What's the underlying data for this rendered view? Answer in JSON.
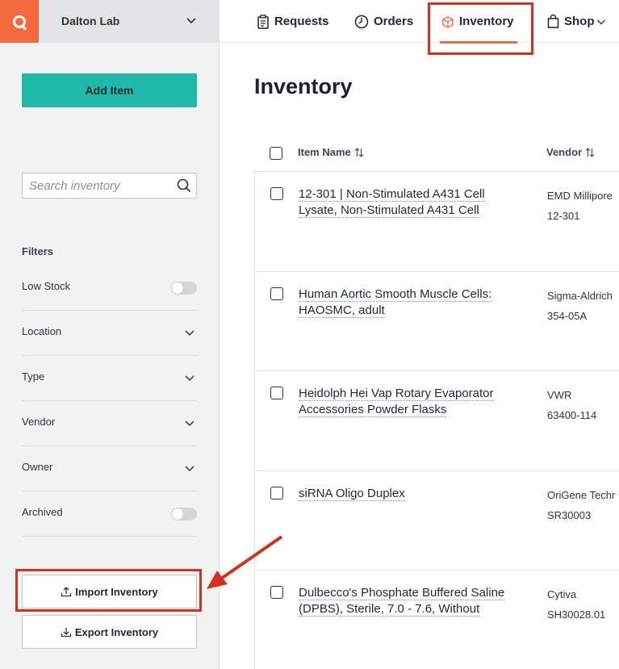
{
  "sidebar": {
    "lab_name": "Dalton Lab",
    "add_item_label": "Add Item",
    "search_placeholder": "Search inventory",
    "filters_title": "Filters",
    "filters": [
      {
        "label": "Low Stock",
        "kind": "toggle",
        "on": false
      },
      {
        "label": "Location",
        "kind": "dropdown"
      },
      {
        "label": "Type",
        "kind": "dropdown"
      },
      {
        "label": "Vendor",
        "kind": "dropdown"
      },
      {
        "label": "Owner",
        "kind": "dropdown"
      },
      {
        "label": "Archived",
        "kind": "toggle",
        "on": false
      }
    ],
    "import_label": "Import Inventory",
    "export_label": "Export Inventory"
  },
  "nav": {
    "items": [
      {
        "label": "Requests",
        "icon": "clipboard-icon"
      },
      {
        "label": "Orders",
        "icon": "clock-icon"
      },
      {
        "label": "Inventory",
        "icon": "box-icon",
        "active": true
      },
      {
        "label": "Shop",
        "icon": "shopping-bag-icon"
      }
    ]
  },
  "main": {
    "title": "Inventory",
    "columns": [
      {
        "label": "Item Name"
      },
      {
        "label": "Vendor"
      }
    ],
    "rows": [
      {
        "name_line1": "12-301 | Non-Stimulated A431 Cell",
        "name_line2": "Lysate, Non-Stimulated A431 Cell",
        "vendor": "EMD Millipore",
        "catalog": "12-301"
      },
      {
        "name_line1": "Human Aortic Smooth Muscle Cells:",
        "name_line2": "HAOSMC, adult",
        "vendor": "Sigma-Aldrich",
        "catalog": "354-05A"
      },
      {
        "name_line1": "Heidolph Hei Vap Rotary Evaporator",
        "name_line2": "Accessories Powder Flasks",
        "vendor": "VWR",
        "catalog": "63400-114"
      },
      {
        "name_line1": "siRNA Oligo Duplex",
        "name_line2": "",
        "vendor": "OriGene Techr",
        "catalog": "SR30003"
      },
      {
        "name_line1": "Dulbecco's Phosphate Buffered Saline",
        "name_line2": "(DPBS), Sterile, 7.0 - 7.6, Without",
        "vendor": "Cytiva",
        "catalog": "SH30028.01"
      }
    ]
  },
  "colors": {
    "accent_teal": "#20b8a9",
    "brand_orange": "#f26a3d",
    "annotation_red": "#d6301e"
  }
}
